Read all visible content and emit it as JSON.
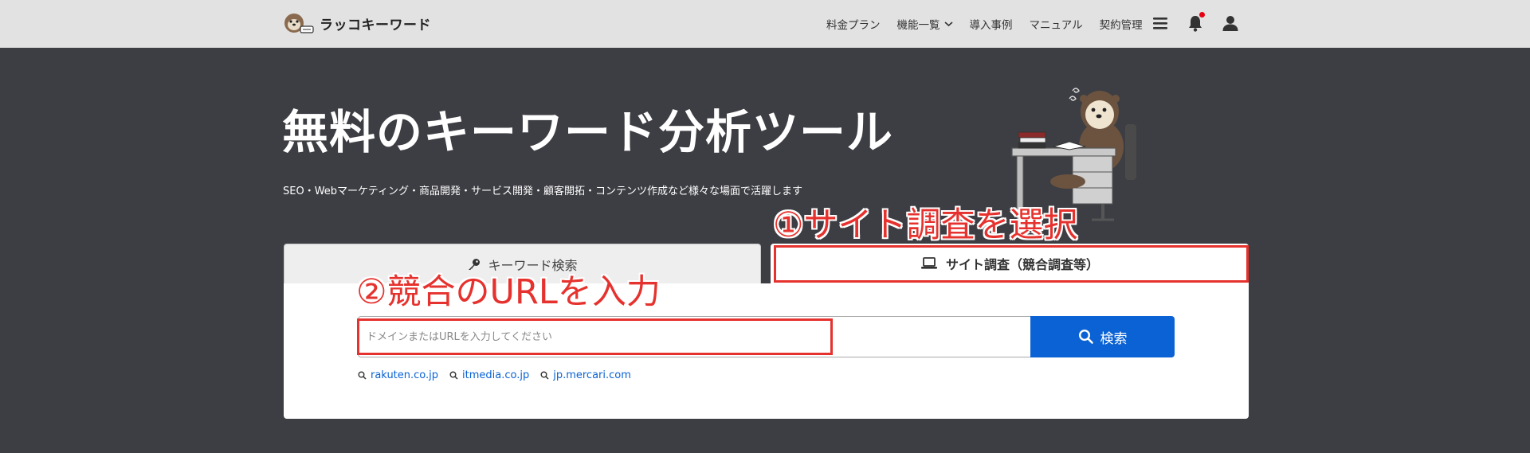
{
  "header": {
    "logo_text": "ラッコキーワード",
    "nav": {
      "pricing": "料金プラン",
      "features": "機能一覧",
      "cases": "導入事例",
      "manual": "マニュアル",
      "contract": "契約管理"
    },
    "icons": [
      "hamburger-icon",
      "bell-icon",
      "user-icon"
    ],
    "notification_color": "#e60012"
  },
  "hero": {
    "title": "無料のキーワード分析ツール",
    "subtitle": "SEO・Webマーケティング・商品開発・サービス開発・顧客開拓・コンテンツ作成など様々な場面で活躍します"
  },
  "tabs": {
    "keyword_search": "キーワード検索",
    "site_research": "サイト調査（競合調査等）"
  },
  "search": {
    "placeholder": "ドメインまたはURLを入力してください",
    "value": "",
    "button_label": "検索",
    "suggestions": [
      "rakuten.co.jp",
      "itmedia.co.jp",
      "jp.mercari.com"
    ]
  },
  "annotations": {
    "step1": "①サイト調査を選択",
    "step2": "②競合のURLを入力"
  },
  "colors": {
    "header_bg": "#e2e2e2",
    "page_bg": "#3d3e43",
    "accent_blue": "#0a62d4",
    "annotation_red": "#e6322e"
  }
}
